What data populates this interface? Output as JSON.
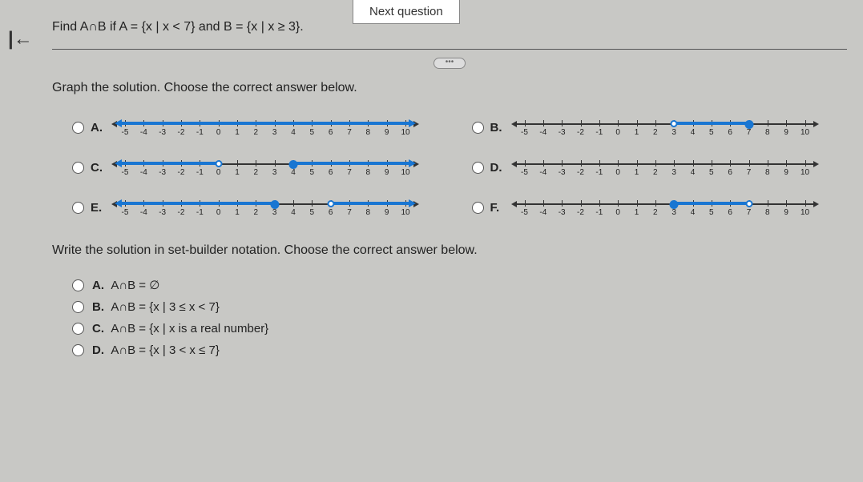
{
  "nav": {
    "next": "Next question"
  },
  "question": "Find A∩B if A = {x | x < 7} and B = {x | x ≥ 3}.",
  "instruction1": "Graph the solution. Choose the correct answer below.",
  "instruction2": "Write the solution in set-builder notation. Choose the correct answer below.",
  "graphLabels": {
    "A": "A.",
    "B": "B.",
    "C": "C.",
    "D": "D.",
    "E": "E.",
    "F": "F."
  },
  "ticks": [
    "-5",
    "-4",
    "-3",
    "-2",
    "-1",
    "0",
    "1",
    "2",
    "3",
    "4",
    "5",
    "6",
    "7",
    "8",
    "9",
    "10"
  ],
  "setOptions": {
    "A": {
      "label": "A.",
      "text": "A∩B = ∅"
    },
    "B": {
      "label": "B.",
      "text": "A∩B = {x | 3 ≤ x < 7}"
    },
    "C": {
      "label": "C.",
      "text": "A∩B = {x | x is a real number}"
    },
    "D": {
      "label": "D.",
      "text": "A∩B = {x | 3 < x ≤ 7}"
    }
  },
  "chart_data": [
    {
      "id": "A",
      "type": "numberline",
      "range": [
        -5,
        10
      ],
      "segments": [
        {
          "from": -6,
          "to": 11,
          "leftArrow": true,
          "rightArrow": true
        }
      ],
      "points": []
    },
    {
      "id": "B",
      "type": "numberline",
      "range": [
        -5,
        10
      ],
      "segments": [
        {
          "from": 3,
          "to": 7
        }
      ],
      "points": [
        {
          "x": 3,
          "kind": "open"
        },
        {
          "x": 7,
          "kind": "closed"
        }
      ]
    },
    {
      "id": "C",
      "type": "numberline",
      "range": [
        -5,
        10
      ],
      "segments": [
        {
          "from": -6,
          "to": 0,
          "leftArrow": true
        },
        {
          "from": 4,
          "to": 11,
          "rightArrow": true
        }
      ],
      "points": [
        {
          "x": 0,
          "kind": "open"
        },
        {
          "x": 4,
          "kind": "closed"
        }
      ]
    },
    {
      "id": "D",
      "type": "numberline",
      "range": [
        -5,
        10
      ],
      "segments": [],
      "points": []
    },
    {
      "id": "E",
      "type": "numberline",
      "range": [
        -5,
        10
      ],
      "segments": [
        {
          "from": -6,
          "to": 3,
          "leftArrow": true
        },
        {
          "from": 6,
          "to": 11,
          "rightArrow": true
        }
      ],
      "points": [
        {
          "x": 3,
          "kind": "closed"
        },
        {
          "x": 6,
          "kind": "open"
        }
      ]
    },
    {
      "id": "F",
      "type": "numberline",
      "range": [
        -5,
        10
      ],
      "segments": [
        {
          "from": 3,
          "to": 7
        }
      ],
      "points": [
        {
          "x": 3,
          "kind": "closed"
        },
        {
          "x": 7,
          "kind": "open"
        }
      ]
    }
  ]
}
